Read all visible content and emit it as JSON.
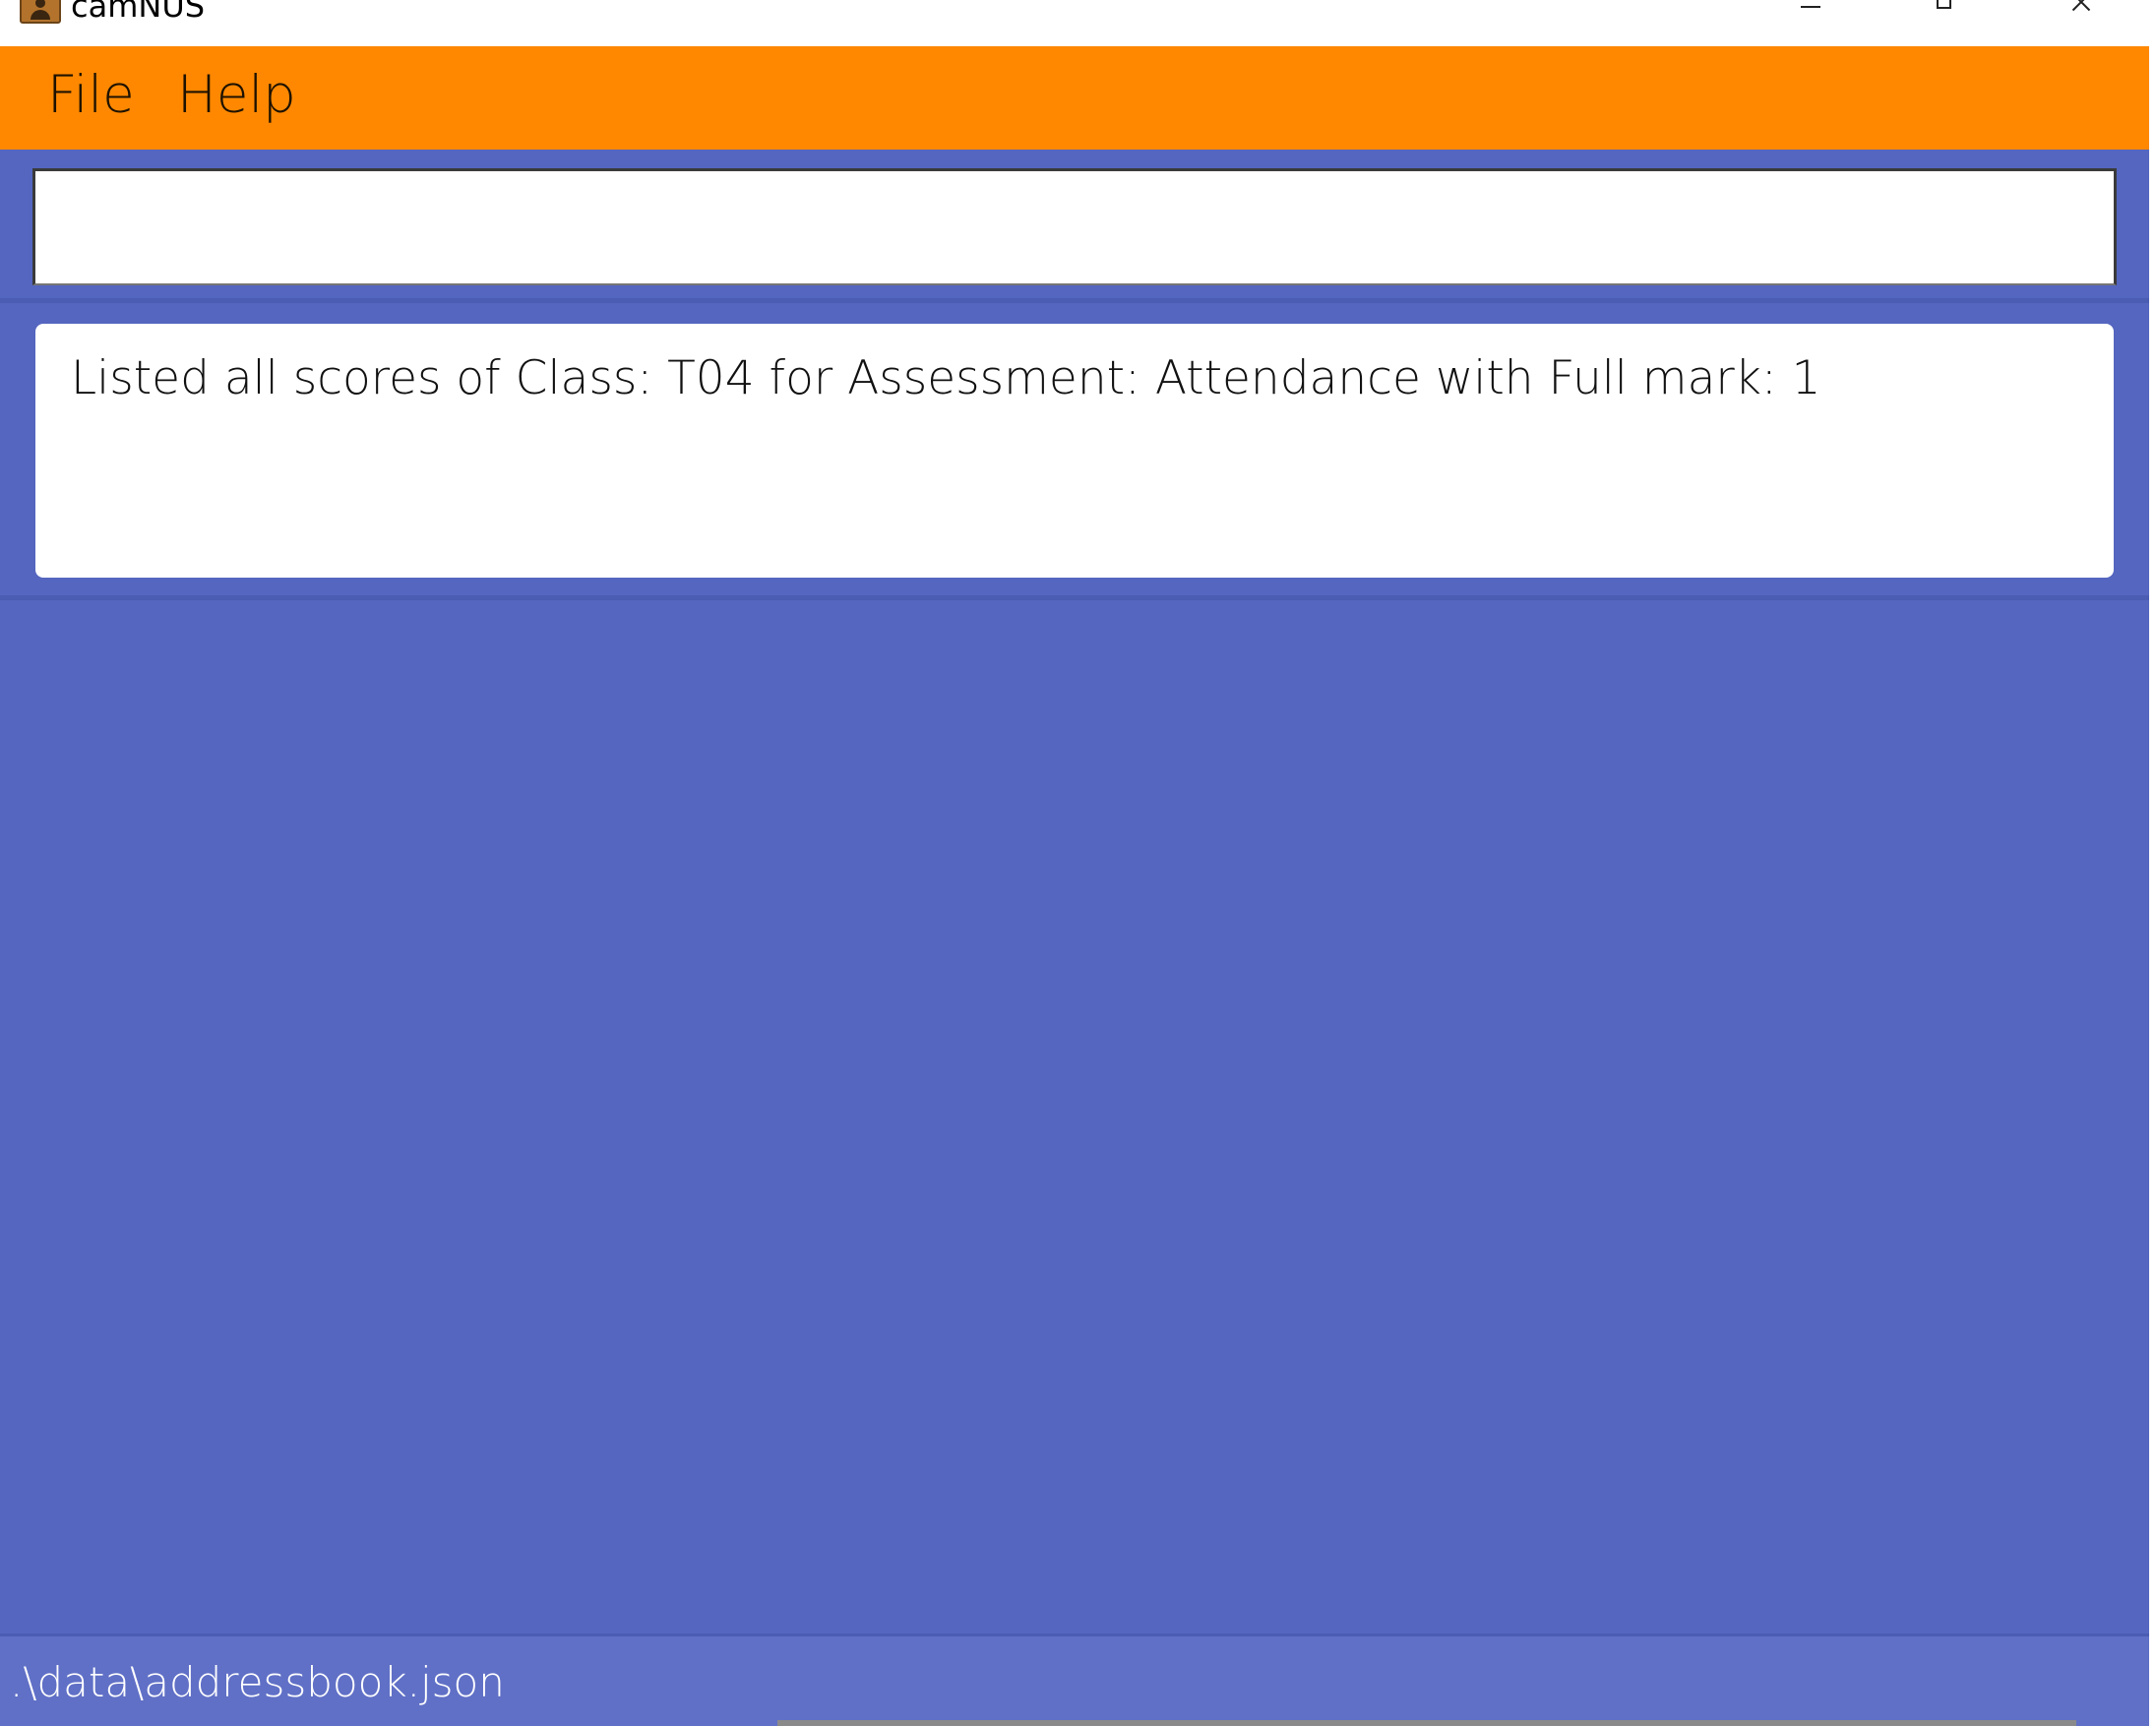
{
  "window": {
    "title": "camNUS",
    "icon": "contacts-book-icon"
  },
  "menubar": {
    "items": [
      {
        "label": "File"
      },
      {
        "label": "Help"
      }
    ]
  },
  "command": {
    "value": "",
    "placeholder": ""
  },
  "result": {
    "message": "Listed all scores of Class: T04 for Assessment: Attendance with Full mark: 1"
  },
  "statusbar": {
    "path": ".\\data\\addressbook.json"
  },
  "colors": {
    "menubar": "#ff8800",
    "main_background": "#5466bf",
    "statusbar": "#6070c6"
  }
}
